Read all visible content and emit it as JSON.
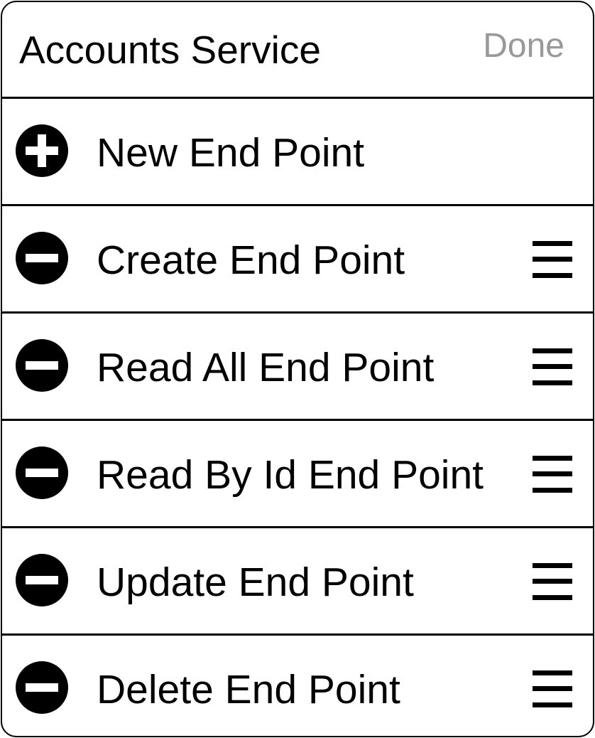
{
  "header": {
    "title": "Accounts Service",
    "done_label": "Done"
  },
  "rows": [
    {
      "label": "New End Point",
      "icon": "add-circle-icon",
      "reorderable": false
    },
    {
      "label": "Create End Point",
      "icon": "remove-circle-icon",
      "reorderable": true
    },
    {
      "label": "Read All End Point",
      "icon": "remove-circle-icon",
      "reorderable": true
    },
    {
      "label": "Read By Id End Point",
      "icon": "remove-circle-icon",
      "reorderable": true
    },
    {
      "label": "Update End Point",
      "icon": "remove-circle-icon",
      "reorderable": true
    },
    {
      "label": "Delete End Point",
      "icon": "remove-circle-icon",
      "reorderable": true
    }
  ],
  "colors": {
    "border": "#000000",
    "done_text": "#999999",
    "background": "#ffffff"
  }
}
